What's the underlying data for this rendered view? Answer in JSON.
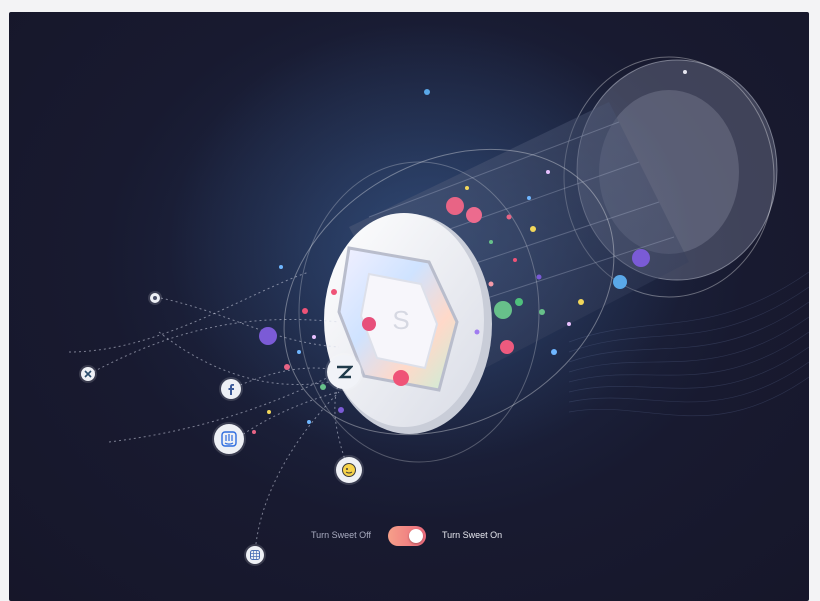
{
  "toggle": {
    "off_label": "Turn Sweet Off",
    "on_label": "Turn Sweet On",
    "state": "on",
    "colors": {
      "start": "#f6a08a",
      "end": "#ec6a7c"
    }
  },
  "integrations": [
    {
      "name": "zendesk-icon"
    },
    {
      "name": "facebook-icon"
    },
    {
      "name": "intercom-icon"
    },
    {
      "name": "mailchimp-icon"
    },
    {
      "name": "small-app-icon"
    },
    {
      "name": "grid-app-icon"
    },
    {
      "name": "close-app-icon"
    }
  ]
}
